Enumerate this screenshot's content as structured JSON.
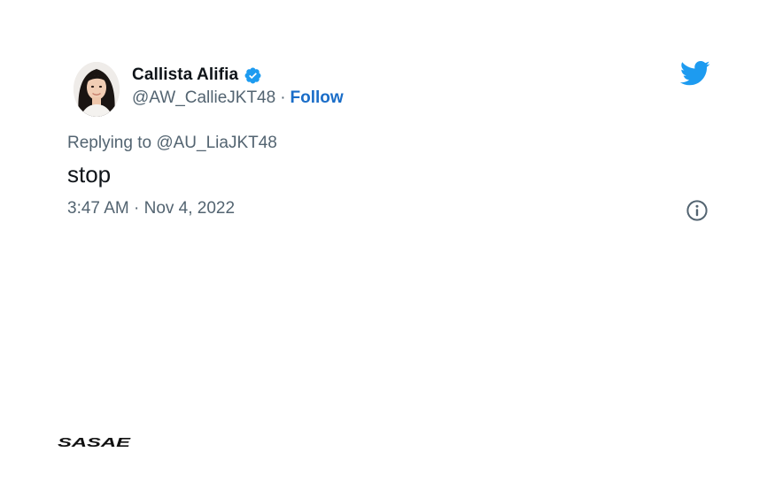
{
  "tweet": {
    "author": {
      "display_name": "Callista Alifia",
      "handle": "@AW_CallieJKT48",
      "verified": true,
      "separator": "·",
      "follow_label": "Follow"
    },
    "reply_context": "Replying to @AU_LiaJKT48",
    "text": "stop",
    "timestamp": "3:47 AM · Nov 4, 2022"
  },
  "icons": {
    "verified": "verified-badge-icon",
    "platform": "twitter-bird-icon",
    "info": "info-icon"
  },
  "brand": {
    "logo_text": "SASAE"
  },
  "colors": {
    "text_primary": "#0f1419",
    "text_secondary": "#536471",
    "link": "#1a6dc8",
    "twitter_blue": "#1d9bf0"
  }
}
